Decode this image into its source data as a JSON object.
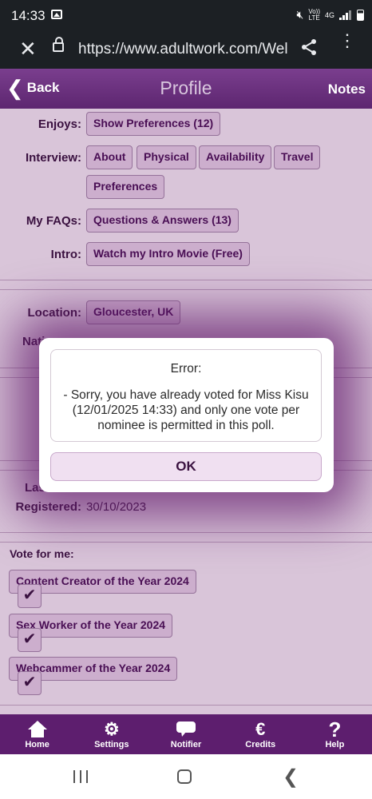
{
  "status_bar": {
    "time": "14:33",
    "network": "4G",
    "volte": "Vo)) LTE",
    "icons": [
      "image-icon",
      "mute-icon",
      "signal-icon",
      "battery-icon"
    ]
  },
  "browser": {
    "url": "https://www.adultwork.com/Wel",
    "icons": [
      "close-icon",
      "lock-icon",
      "share-icon",
      "menu-icon"
    ]
  },
  "header": {
    "back_label": "Back",
    "title": "Profile",
    "notes_label": "Notes"
  },
  "profile": {
    "enjoys_label": "Enjoys:",
    "enjoys_button": "Show Preferences (12)",
    "interview_label": "Interview:",
    "interview_buttons": [
      "About",
      "Physical",
      "Availability",
      "Travel",
      "Preferences"
    ],
    "faqs_label": "My FAQs:",
    "faqs_button": "Questions & Answers (13)",
    "intro_label": "Intro:",
    "intro_button": "Watch my Intro Movie (Free)",
    "location_label": "Location:",
    "location_value": "Gloucester, UK",
    "nationality_label_partial": "Nati",
    "registered_label": "Registered:",
    "registered_value": "30/10/2023",
    "last_label_partial": "Las"
  },
  "vote": {
    "title": "Vote for me:",
    "items": [
      {
        "label": "Content Creator of the Year 2024",
        "check": "✔"
      },
      {
        "label": "Sex Worker of the Year 2024",
        "check": "✔"
      },
      {
        "label": "Webcammer of the Year 2024",
        "check": "✔"
      }
    ]
  },
  "dialog": {
    "heading": "Error:",
    "message": "- Sorry, you have already voted for Miss Kisu (12/01/2025 14:33) and only one vote per nominee is permitted in this poll.",
    "ok_label": "OK"
  },
  "bottom_nav": [
    {
      "label": "Home",
      "icon": "home-icon"
    },
    {
      "label": "Settings",
      "icon": "gear-icon"
    },
    {
      "label": "Notifier",
      "icon": "chat-bubble-icon"
    },
    {
      "label": "Credits",
      "icon": "euro-icon"
    },
    {
      "label": "Help",
      "icon": "question-icon"
    }
  ],
  "colors": {
    "brand_purple": "#5d1e6e",
    "background": "#e7d5e6",
    "button": "#d8bcd9"
  }
}
